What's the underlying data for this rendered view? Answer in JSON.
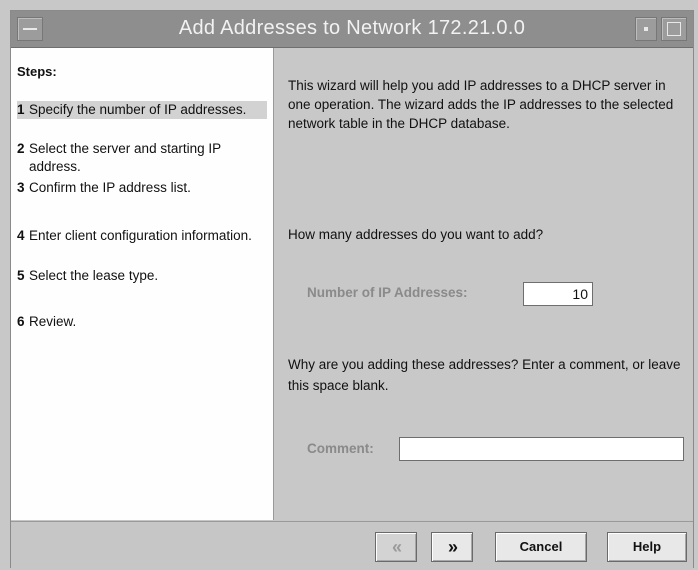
{
  "window": {
    "title": "Add Addresses to Network 172.21.0.0"
  },
  "sidebar": {
    "heading": "Steps:",
    "steps": [
      {
        "num": "1",
        "text": "Specify the number of IP addresses."
      },
      {
        "num": "2",
        "text": "Select the server and starting IP address."
      },
      {
        "num": "3",
        "text": "Confirm the IP address list."
      },
      {
        "num": "4",
        "text": "Enter client configuration information."
      },
      {
        "num": "5",
        "text": "Select the lease type."
      },
      {
        "num": "6",
        "text": "Review."
      }
    ]
  },
  "content": {
    "intro": "This wizard will help you add IP addresses to a DHCP server in one operation.  The wizard adds the IP addresses to the selected network table in the DHCP database.",
    "question": "How many addresses do you want to add?",
    "num_label": "Number of IP Addresses:",
    "num_value": "10",
    "why": "Why are you adding these addresses? Enter a comment, or leave this space blank.",
    "comment_label": "Comment:",
    "comment_value": ""
  },
  "footer": {
    "back_glyph": "«",
    "next_glyph": "»",
    "cancel": "Cancel",
    "help": "Help"
  }
}
